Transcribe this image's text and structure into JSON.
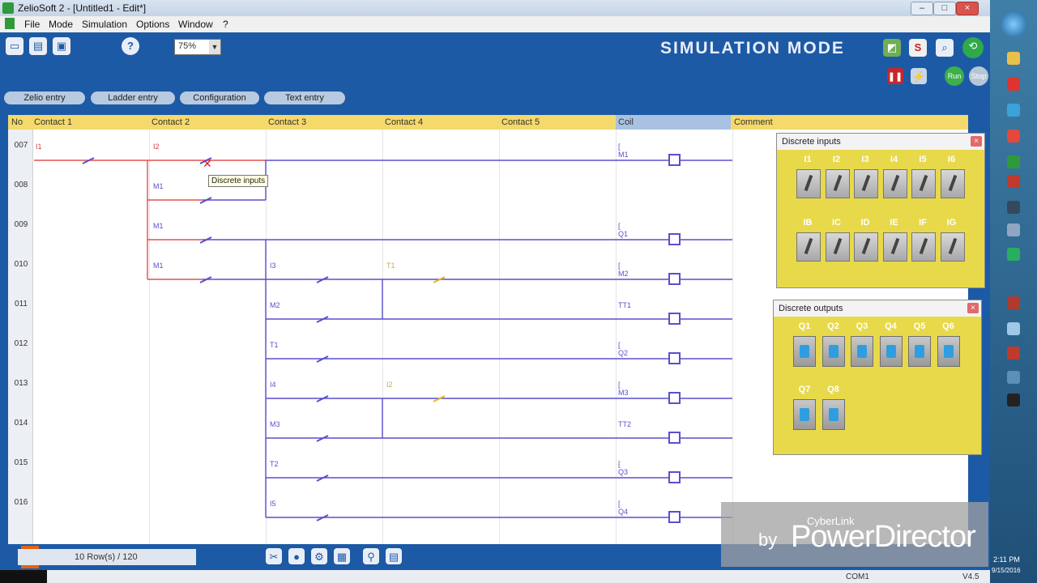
{
  "window": {
    "title": "ZelioSoft 2 - [Untitled1 - Edit*]",
    "help_glyph": "?"
  },
  "menu": [
    "File",
    "Mode",
    "Simulation",
    "Options",
    "Window",
    "?"
  ],
  "toolbar": {
    "zoom": "75%",
    "mode_label": "SIMULATION MODE",
    "s_label": "S",
    "run": "Run",
    "stop": "Stop"
  },
  "tabs": [
    "Zelio entry",
    "Ladder entry",
    "Configuration",
    "Text entry"
  ],
  "grid": {
    "headers": [
      "No",
      "Contact 1",
      "Contact 2",
      "Contact 3",
      "Contact 4",
      "Contact 5",
      "Coil",
      "Comment"
    ],
    "rows": [
      "007",
      "008",
      "009",
      "010",
      "011",
      "012",
      "013",
      "014",
      "015",
      "016"
    ],
    "contacts": [
      {
        "text": "I1",
        "row": 0,
        "col": "c1"
      },
      {
        "text": "I2",
        "row": 0,
        "col": "c2"
      },
      {
        "text": "M1",
        "row": 1,
        "col": "c2"
      },
      {
        "text": "M1",
        "row": 2,
        "col": "c2"
      },
      {
        "text": "M1",
        "row": 3,
        "col": "c2"
      },
      {
        "text": "I3",
        "row": 3,
        "col": "c3"
      },
      {
        "text": "T1",
        "row": 3,
        "col": "c4"
      },
      {
        "text": "M2",
        "row": 4,
        "col": "c3"
      },
      {
        "text": "T1",
        "row": 5,
        "col": "c3"
      },
      {
        "text": "I4",
        "row": 6,
        "col": "c3"
      },
      {
        "text": "I2",
        "row": 6,
        "col": "c4"
      },
      {
        "text": "M3",
        "row": 7,
        "col": "c3"
      },
      {
        "text": "T2",
        "row": 8,
        "col": "c3"
      },
      {
        "text": "I5",
        "row": 9,
        "col": "c3"
      }
    ],
    "coils": [
      {
        "text": "[ M1",
        "row": 0
      },
      {
        "text": "[ Q1",
        "row": 2
      },
      {
        "text": "[ M2",
        "row": 3
      },
      {
        "text": "TT1",
        "row": 4
      },
      {
        "text": "[ Q2",
        "row": 5
      },
      {
        "text": "[ M3",
        "row": 6
      },
      {
        "text": "TT2",
        "row": 7
      },
      {
        "text": "[ Q3",
        "row": 8
      },
      {
        "text": "[ Q4",
        "row": 9
      }
    ],
    "tooltip": "Discrete inputs"
  },
  "discrete_inputs": {
    "title": "Discrete inputs",
    "row1": [
      "I1",
      "I2",
      "I3",
      "I4",
      "I5",
      "I6"
    ],
    "row2": [
      "IB",
      "IC",
      "ID",
      "IE",
      "IF",
      "IG"
    ]
  },
  "discrete_outputs": {
    "title": "Discrete outputs",
    "row1": [
      "Q1",
      "Q2",
      "Q3",
      "Q4",
      "Q5",
      "Q6"
    ],
    "row2": [
      "Q7",
      "Q8"
    ]
  },
  "status": {
    "rows": "10 Row(s) / 120",
    "port": "COM1",
    "version": "V4.5"
  },
  "watermark": {
    "cyberlink": "CyberLink",
    "by": "by",
    "product": "PowerDirector"
  },
  "taskbar_time": {
    "time": "2:11 PM",
    "date": "9/15/2016"
  }
}
